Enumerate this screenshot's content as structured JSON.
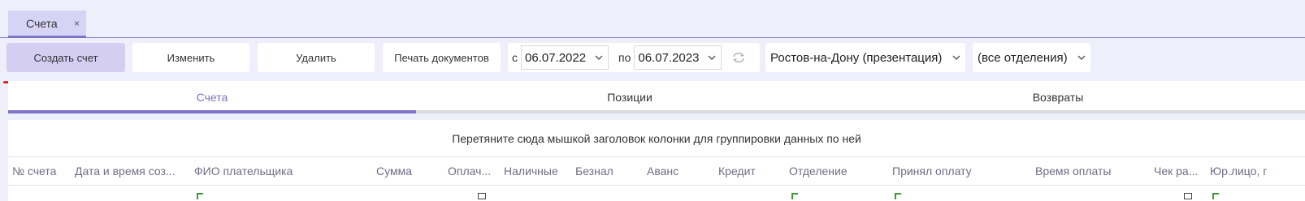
{
  "tabs": {
    "active_label": "Счета",
    "close_glyph": "×"
  },
  "toolbar": {
    "create_label": "Создать счет",
    "edit_label": "Изменить",
    "delete_label": "Удалить",
    "print_label": "Печать документов"
  },
  "date_filter": {
    "from_label": "с",
    "from_value": "06.07.2022",
    "to_label": "по",
    "to_value": "06.07.2023"
  },
  "city_select": {
    "value": "Ростов-на-Дону (презентация)"
  },
  "department_select": {
    "value": "(все отделения)"
  },
  "subtabs": [
    "Счета",
    "Позиции",
    "Возвраты"
  ],
  "grid": {
    "group_hint": "Перетяните сюда мышкой заголовок колонки для группировки данных по ней",
    "columns": [
      "№ счета",
      "Дата и время соз...",
      "ФИО плательщика",
      "Сумма",
      "Оплач...",
      "Наличные",
      "Безнал",
      "Аванс",
      "Кредит",
      "Отделение",
      "Принял оплату",
      "Время оплаты",
      "Чек ра...",
      "Юр.лицо, г"
    ]
  },
  "colors": {
    "accent": "#7d74c8",
    "primary_button": "#d3cef2",
    "annotation_red": "#e0262a"
  }
}
